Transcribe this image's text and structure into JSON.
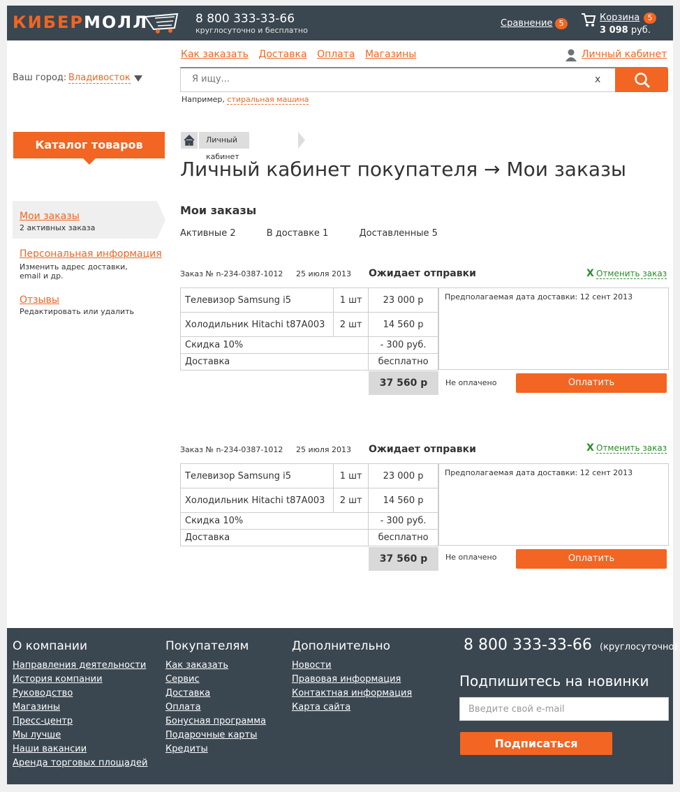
{
  "header": {
    "logo_part1": "КИБЕР",
    "logo_part2": "МОЛЛ",
    "phone": "8 800 333-33-66",
    "phone_sub": "круглосуточно и бесплатно",
    "compare_label": "Сравнение",
    "compare_count": "5",
    "cart_label": "Корзина",
    "cart_count": "5",
    "cart_sum": "3 098",
    "cart_currency": "руб."
  },
  "topnav": [
    "Как заказать",
    "Доставка",
    "Оплата",
    "Магазины"
  ],
  "account_link": "Личный кабинет",
  "city": {
    "label": "Ваш город:",
    "value": "Владивосток"
  },
  "search": {
    "placeholder": "Я ищу...",
    "clear": "x",
    "example_prefix": "Например,",
    "example_link": "стиральная машина"
  },
  "catalog_button": "Каталог товаров",
  "sidebar": [
    {
      "label": "Мои заказы",
      "sub": "2 активных заказа"
    },
    {
      "label": "Персональная информация",
      "sub": "Изменить адрес доставки,\nemail и др."
    },
    {
      "label": "Отзывы",
      "sub": "Редактировать или удалить"
    }
  ],
  "breadcrumb": "Личный кабинет",
  "page_title": "Личный кабинет покупателя → Мои заказы",
  "section_title": "Мои заказы",
  "tabs": [
    "Активные 2",
    "В доставке 1",
    "Доставленные 5"
  ],
  "orders": [
    {
      "number": "Заказ № n-234-0387-1012",
      "date": "25 июля 2013",
      "status": "Ожидает отправки",
      "cancel_x": "X",
      "cancel_label": "Отменить заказ",
      "items": [
        {
          "name": "Телевизор Samsung i5",
          "qty": "1 шт",
          "price": "23 000 р"
        },
        {
          "name": "Холодильник Hitachi t87A003",
          "qty": "2 шт",
          "price": "14 560 р"
        }
      ],
      "discount_label": "Скидка 10%",
      "discount_value": "- 300 руб.",
      "delivery_label": "Доставка",
      "delivery_value": "бесплатно",
      "delivery_date": "Предполагаемая дата доставки: 12 сент 2013",
      "total": "37 560 р",
      "payment_status": "Не оплачено",
      "pay_button": "Оплатить"
    },
    {
      "number": "Заказ № n-234-0387-1012",
      "date": "25 июля 2013",
      "status": "Ожидает отправки",
      "cancel_x": "X",
      "cancel_label": "Отменить заказ",
      "items": [
        {
          "name": "Телевизор Samsung i5",
          "qty": "1 шт",
          "price": "23 000 р"
        },
        {
          "name": "Холодильник Hitachi t87A003",
          "qty": "2 шт",
          "price": "14 560 р"
        }
      ],
      "discount_label": "Скидка 10%",
      "discount_value": "- 300 руб.",
      "delivery_label": "Доставка",
      "delivery_value": "бесплатно",
      "delivery_date": "Предполагаемая дата доставки: 12 сент 2013",
      "total": "37 560 р",
      "payment_status": "Не оплачено",
      "pay_button": "Оплатить"
    }
  ],
  "footer": {
    "columns": [
      {
        "title": "О компании",
        "links": [
          "Направления деятельности",
          "История компании",
          "Руководство",
          "Магазины",
          "Пресс-центр",
          "Мы лучше",
          "Наши вакансии",
          "Аренда торговых площадей"
        ]
      },
      {
        "title": "Покупателям",
        "links": [
          "Как заказать",
          "Сервис",
          "Доставка",
          "Оплата",
          "Бонусная программа",
          "Подарочные карты",
          "Кредиты"
        ]
      },
      {
        "title": "Дополнительно",
        "links": [
          "Новости",
          "Правовая информация",
          "Контактная информация",
          "Карта сайта"
        ]
      }
    ],
    "phone": "8 800 333-33-66",
    "phone_note": "(круглосуточно)",
    "subscribe_title": "Подпишитесь на новинки",
    "email_placeholder": "Введите свой e-mail",
    "subscribe_button": "Подписаться"
  },
  "colors": {
    "accent": "#f26522",
    "dark": "#3a4650",
    "green": "#2a8c2a"
  }
}
